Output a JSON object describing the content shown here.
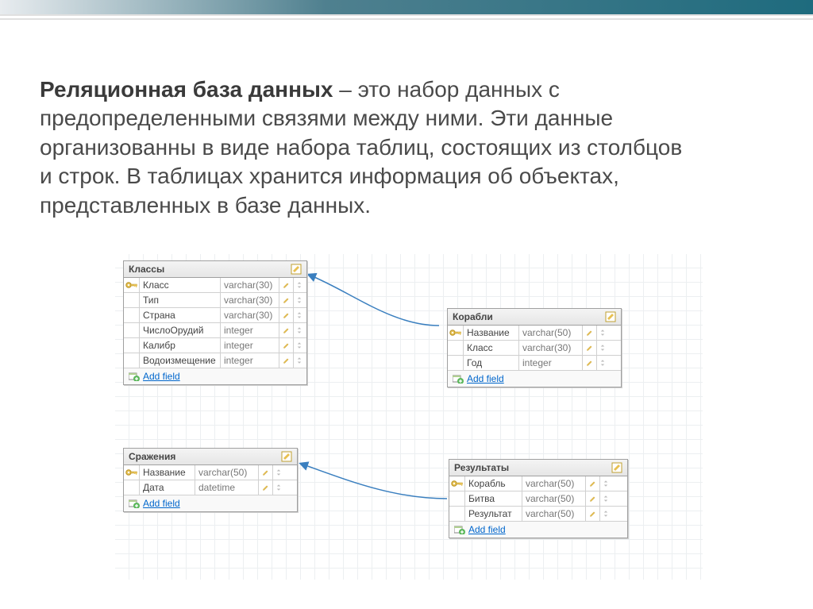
{
  "intro": {
    "bold": "Реляционная база данных",
    "rest": " – это набор данных с предопределенными связями между ними. Эти данные организованны в виде набора таблиц, состоящих из столбцов и строк. В таблицах хранится информация об объектах, представленных в базе данных."
  },
  "add_field_label": "Add field",
  "tables": {
    "classes": {
      "title": "Классы",
      "fields": [
        {
          "pk": true,
          "name": "Класс",
          "type": "varchar(30)"
        },
        {
          "pk": false,
          "name": "Тип",
          "type": "varchar(30)"
        },
        {
          "pk": false,
          "name": "Страна",
          "type": "varchar(30)"
        },
        {
          "pk": false,
          "name": "ЧислоОрудий",
          "type": "integer"
        },
        {
          "pk": false,
          "name": "Калибр",
          "type": "integer"
        },
        {
          "pk": false,
          "name": "Водоизмещение",
          "type": "integer"
        }
      ]
    },
    "ships": {
      "title": "Корабли",
      "fields": [
        {
          "pk": true,
          "name": "Название",
          "type": "varchar(50)"
        },
        {
          "pk": false,
          "name": "Класс",
          "type": "varchar(30)"
        },
        {
          "pk": false,
          "name": "Год",
          "type": "integer"
        }
      ]
    },
    "battles": {
      "title": "Сражения",
      "fields": [
        {
          "pk": true,
          "name": "Название",
          "type": "varchar(50)"
        },
        {
          "pk": false,
          "name": "Дата",
          "type": "datetime"
        }
      ]
    },
    "results": {
      "title": "Результаты",
      "fields": [
        {
          "pk": true,
          "name": "Корабль",
          "type": "varchar(50)"
        },
        {
          "pk": false,
          "name": "Битва",
          "type": "varchar(50)"
        },
        {
          "pk": false,
          "name": "Результат",
          "type": "varchar(50)"
        }
      ]
    }
  }
}
